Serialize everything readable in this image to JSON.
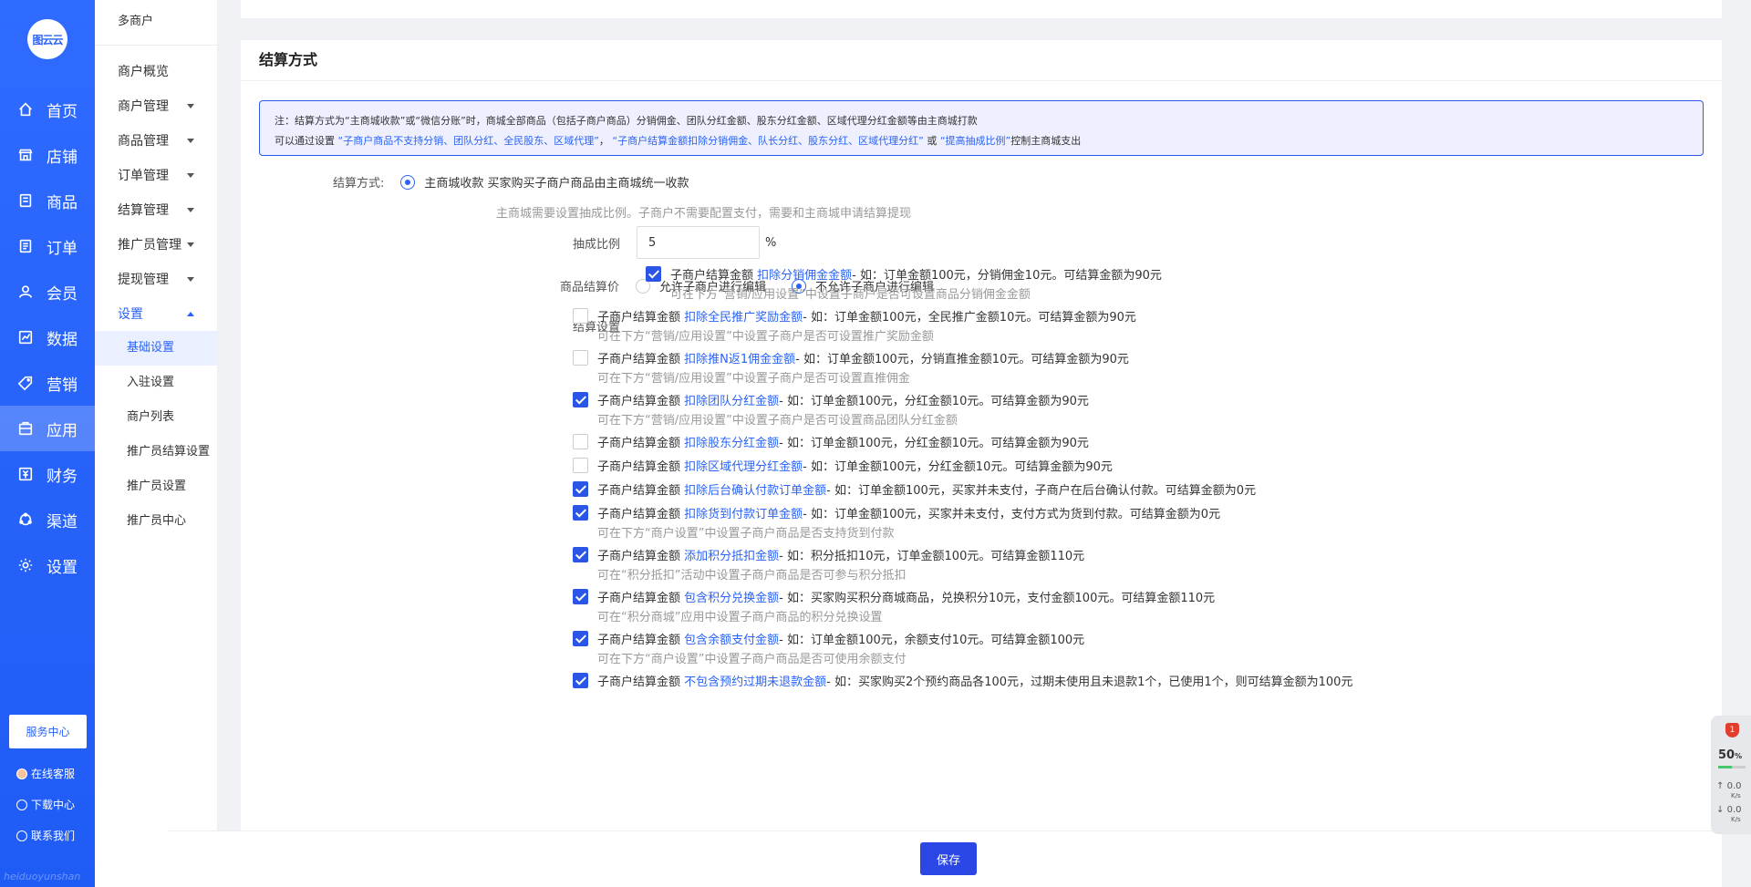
{
  "app": {
    "logo_text": "图云云",
    "watermark": "heiduoyunshan"
  },
  "main_nav": [
    {
      "label": "首页",
      "icon": "home-icon"
    },
    {
      "label": "店铺",
      "icon": "store-icon"
    },
    {
      "label": "商品",
      "icon": "goods-icon"
    },
    {
      "label": "订单",
      "icon": "order-icon"
    },
    {
      "label": "会员",
      "icon": "member-icon"
    },
    {
      "label": "数据",
      "icon": "data-icon"
    },
    {
      "label": "营销",
      "icon": "tag-icon"
    },
    {
      "label": "应用",
      "icon": "app-icon",
      "active": true
    },
    {
      "label": "财务",
      "icon": "finance-icon"
    },
    {
      "label": "渠道",
      "icon": "channel-icon"
    },
    {
      "label": "设置",
      "icon": "gear-icon"
    }
  ],
  "side_bottom": {
    "service_center": "服务中心",
    "online_service": "在线客服",
    "download_center": "下载中心",
    "contact_us": "联系我们"
  },
  "sub_nav": {
    "title": "多商户",
    "items": [
      {
        "label": "商户概览",
        "caret": false
      },
      {
        "label": "商户管理",
        "caret": true
      },
      {
        "label": "商品管理",
        "caret": true
      },
      {
        "label": "订单管理",
        "caret": true
      },
      {
        "label": "结算管理",
        "caret": true
      },
      {
        "label": "推广员管理",
        "caret": true
      },
      {
        "label": "提现管理",
        "caret": true
      },
      {
        "label": "设置",
        "caret": true,
        "open": true
      }
    ],
    "children": [
      {
        "label": "基础设置",
        "active": true
      },
      {
        "label": "入驻设置"
      },
      {
        "label": "商户列表"
      },
      {
        "label": "推广员结算设置"
      },
      {
        "label": "推广员设置"
      },
      {
        "label": "推广员中心"
      }
    ]
  },
  "section": {
    "title": "结算方式",
    "notice_line1": "注：结算方式为“主商城收款”或“微信分账”时，商城全部商品（包括子商户商品）分销佣金、团队分红金额、股东分红金额、区域代理分红金额等由主商城打款",
    "notice_line2_prefix": "可以通过设置",
    "notice_line2_hl1": "“子商户商品不支持分销、团队分红、全民股东、区域代理”",
    "notice_line2_sep1": "，",
    "notice_line2_hl2": "“子商户结算金额扣除分销佣金、队长分红、股东分红、区域代理分红”",
    "notice_line2_sep2": "或",
    "notice_line2_hl3": "“提高抽成比例”",
    "notice_line2_suffix": "控制主商城支出",
    "method_label": "结算方式:",
    "method_value": "主商城收款 买家购买子商户商品由主商城统一收款",
    "method_tip": "主商城需要设置抽成比例。子商户不需要配置支付，需要和主商城申请结算提现",
    "ratio_label": "抽成比例",
    "ratio_value": "5",
    "ratio_unit": "%",
    "price_label": "商品结算价",
    "price_opt1": "允许子商户进行编辑",
    "price_opt2": "不允许子商户进行编辑",
    "settle_label": "结算设置",
    "options": [
      {
        "checked": true,
        "prefix": "子商户结算金额",
        "link": "扣除分销佣金金额",
        "desc": " - 如：订单金额100元，分销佣金10元。可结算金额为90元",
        "tip": "可在下方“营销/应用设置”中设置子商户是否可设置商品分销佣金金额"
      },
      {
        "checked": false,
        "prefix": "子商户结算金额",
        "link": "扣除全民推广奖励金额",
        "desc": " - 如：订单金额100元，全民推广金额10元。可结算金额为90元",
        "tip": "可在下方“营销/应用设置”中设置子商户是否可设置推广奖励金额"
      },
      {
        "checked": false,
        "prefix": "子商户结算金额",
        "link": "扣除推N返1佣金金额",
        "desc": " - 如：订单金额100元，分销直推金额10元。可结算金额为90元",
        "tip": "可在下方“营销/应用设置”中设置子商户是否可设置直推佣金"
      },
      {
        "checked": true,
        "prefix": "子商户结算金额",
        "link": "扣除团队分红金额",
        "desc": " - 如：订单金额100元，分红金额10元。可结算金额为90元",
        "tip": "可在下方“营销/应用设置”中设置子商户是否可设置商品团队分红金额"
      },
      {
        "checked": false,
        "prefix": "子商户结算金额",
        "link": "扣除股东分红金额",
        "desc": " - 如：订单金额100元，分红金额10元。可结算金额为90元",
        "tip": ""
      },
      {
        "checked": false,
        "prefix": "子商户结算金额",
        "link": "扣除区域代理分红金额",
        "desc": " - 如：订单金额100元，分红金额10元。可结算金额为90元",
        "tip": ""
      },
      {
        "checked": true,
        "prefix": "子商户结算金额",
        "link": "扣除后台确认付款订单金额",
        "desc": " - 如：订单金额100元，买家并未支付，子商户在后台确认付款。可结算金额为0元",
        "tip": ""
      },
      {
        "checked": true,
        "prefix": "子商户结算金额",
        "link": "扣除货到付款订单金额",
        "desc": " - 如：订单金额100元，买家并未支付，支付方式为货到付款。可结算金额为0元",
        "tip": "可在下方“商户设置”中设置子商户商品是否支持货到付款"
      },
      {
        "checked": true,
        "prefix": "子商户结算金额",
        "link": "添加积分抵扣金额",
        "desc": " - 如：积分抵扣10元，订单金额100元。可结算金额110元",
        "tip": "可在“积分抵扣”活动中设置子商户商品是否可参与积分抵扣"
      },
      {
        "checked": true,
        "prefix": "子商户结算金额",
        "link": "包含积分兑换金额",
        "desc": " - 如：买家购买积分商城商品，兑换积分10元，支付金额100元。可结算金额110元",
        "tip": "可在“积分商城”应用中设置子商户商品的积分兑换设置"
      },
      {
        "checked": true,
        "prefix": "子商户结算金额",
        "link": "包含余额支付金额",
        "desc": " - 如：订单金额100元，余额支付10元。可结算金额100元",
        "tip": "可在下方“商户设置”中设置子商户商品是否可使用余额支付"
      },
      {
        "checked": true,
        "prefix": "子商户结算金额",
        "link": "不包含预约过期未退款金额",
        "desc": " - 如：买家购买2个预约商品各100元，过期未使用且未退款1个，已使用1个，则可结算金额为100元",
        "tip": ""
      }
    ]
  },
  "footer": {
    "save_label": "保存"
  },
  "monitor": {
    "badge": "1",
    "percent": "50",
    "percent_unit": "%",
    "cpu_fill": 0.5,
    "up_value": "0.0",
    "up_unit": "K/s",
    "down_value": "0.0",
    "down_unit": "K/s"
  },
  "colors": {
    "primary": "#2a63f6",
    "sidebar": "#1f5bf5",
    "notice_bg": "#eef0ff",
    "save_button": "#2a47e6"
  }
}
